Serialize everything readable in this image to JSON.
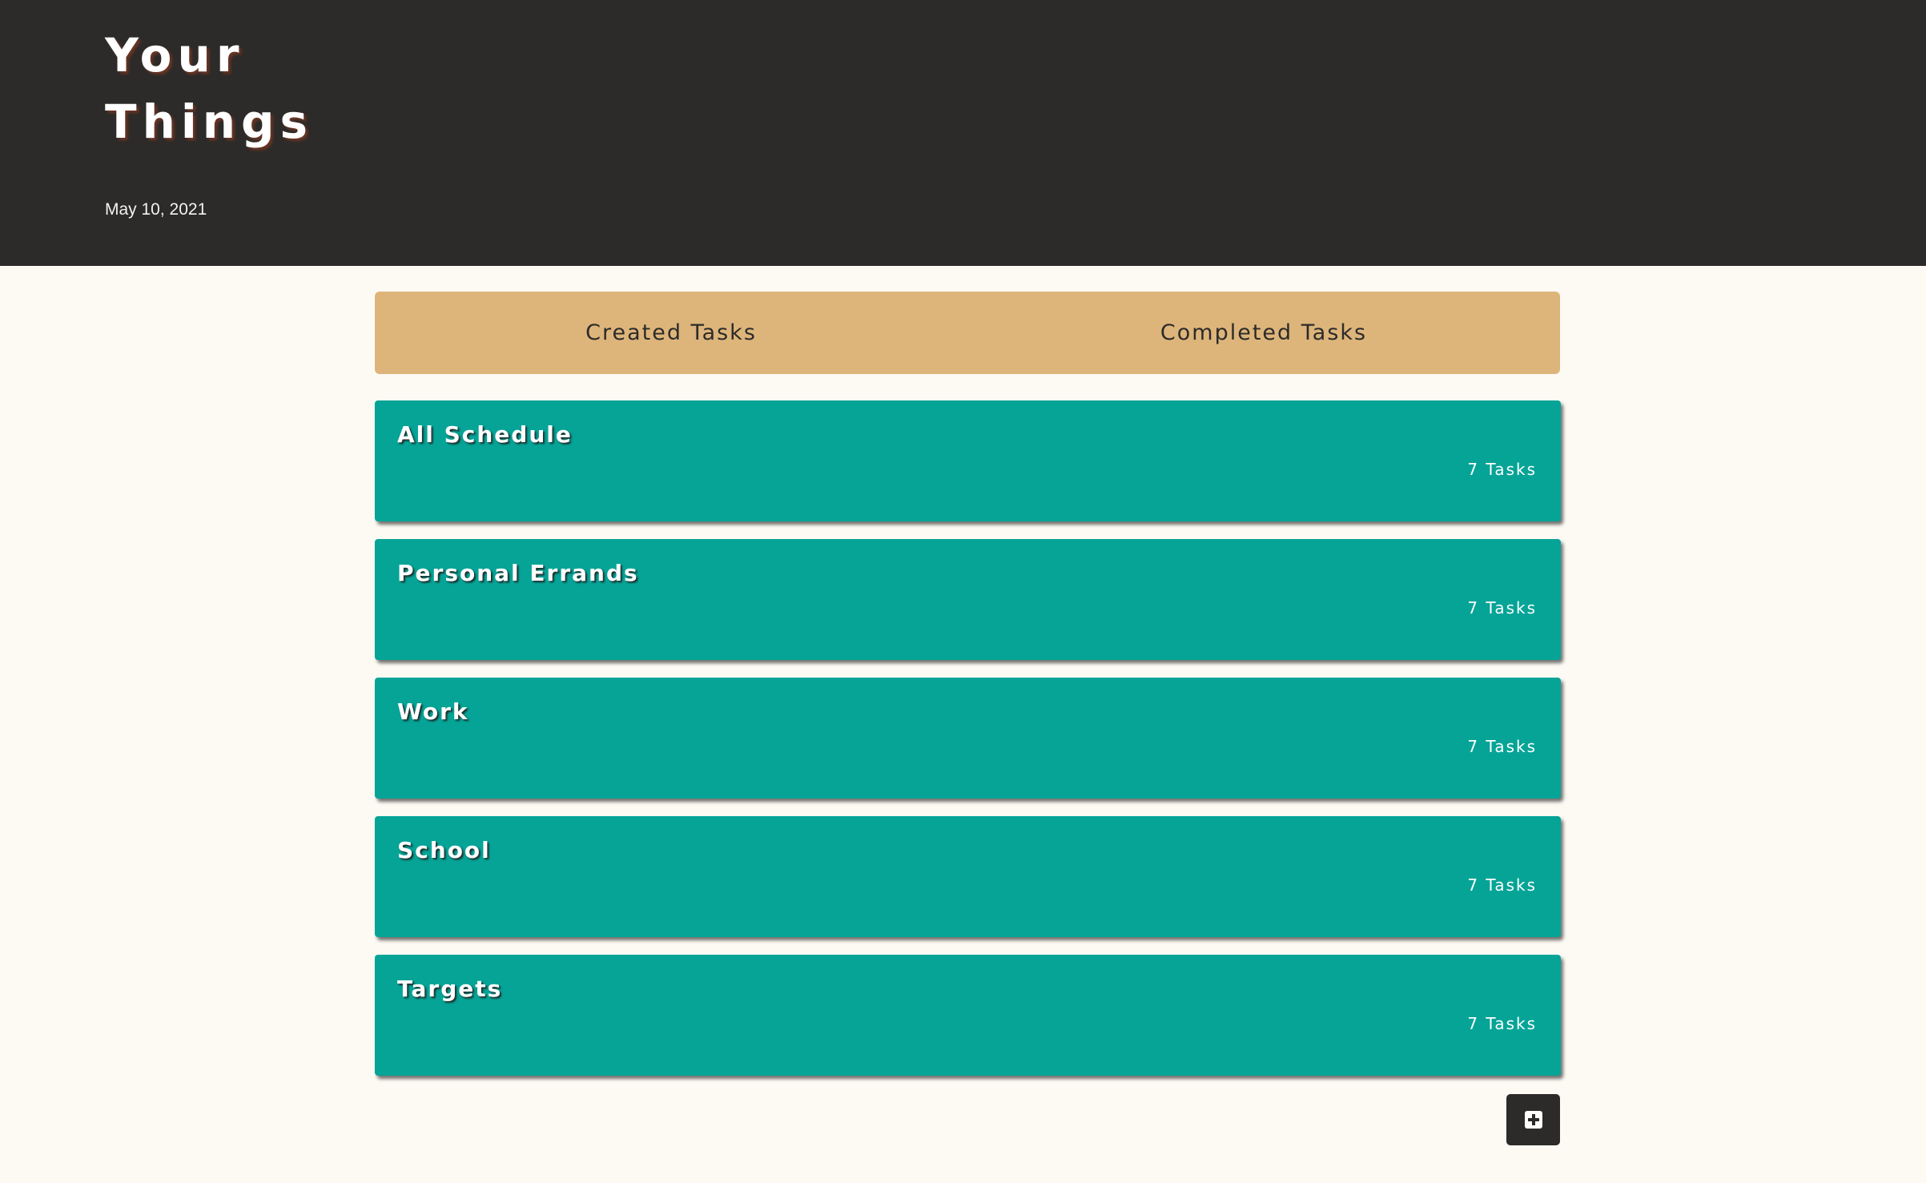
{
  "header": {
    "title_line1": "Your",
    "title_line2": "Things",
    "date": "May 10, 2021"
  },
  "tabs": [
    {
      "label": "Created Tasks"
    },
    {
      "label": "Completed Tasks"
    }
  ],
  "categories": [
    {
      "name": "All Schedule",
      "count": "7 Tasks"
    },
    {
      "name": "Personal Errands",
      "count": "7 Tasks"
    },
    {
      "name": "Work",
      "count": "7 Tasks"
    },
    {
      "name": "School",
      "count": "7 Tasks"
    },
    {
      "name": "Targets",
      "count": "7 Tasks"
    }
  ],
  "add_button": {
    "icon": "plus-square-icon"
  },
  "colors": {
    "header_bg": "#2d2b29",
    "tab_bar_bg": "#ddb57b",
    "card_bg": "#05a497",
    "page_bg": "#fdfaf4"
  }
}
